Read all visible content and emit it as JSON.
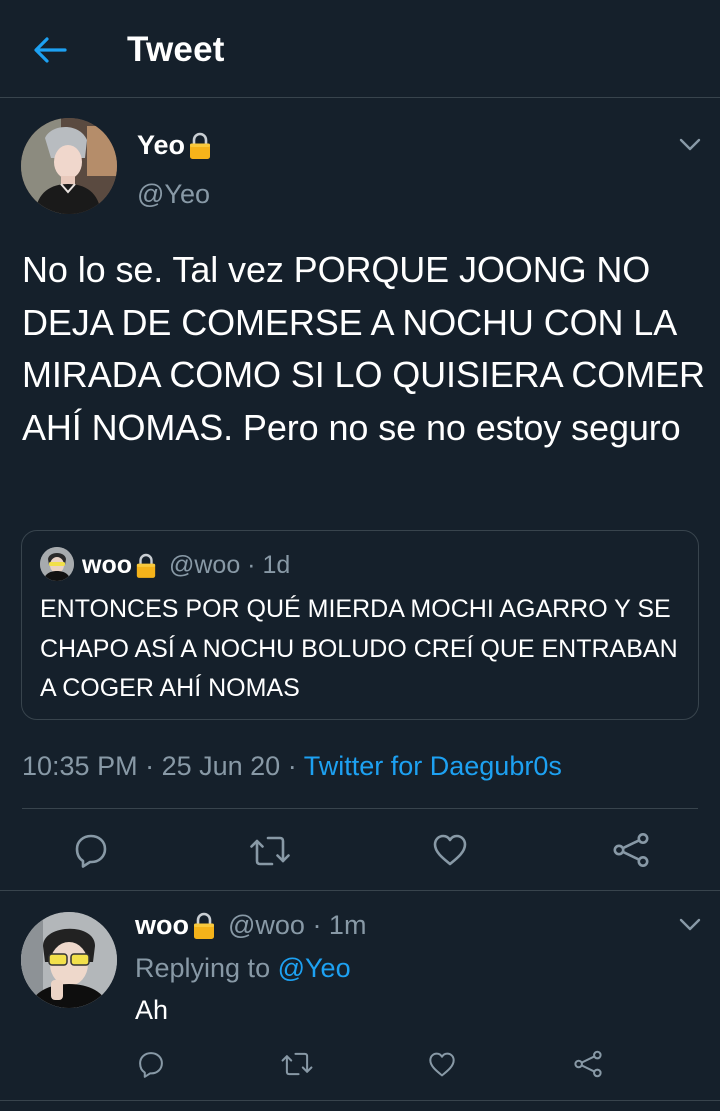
{
  "header": {
    "title": "Tweet"
  },
  "tweet": {
    "author_name": "Yeo",
    "author_handle": "@Yeo",
    "text": "No lo se. Tal vez PORQUE JOONG NO DEJA DE COMERSE A NOCHU CON LA MIRADA COMO SI LO QUISIERA COMER AHÍ NOMAS. Pero no se no estoy seguro",
    "time": "10:35 PM",
    "date": "25 Jun 20",
    "source": "Twitter for Daegubr0s",
    "quote": {
      "author_name": "woo",
      "meta": "@woo · 1d",
      "text": "ENTONCES POR QUÉ MIERDA MOCHI AGARRO Y SE CHAPO ASÍ A NOCHU BOLUDO CREÍ QUE ENTRABAN A COGER AHÍ NOMAS"
    }
  },
  "reply": {
    "author_name": "woo",
    "meta": "@woo · 1m",
    "replying_prefix": "Replying to",
    "replying_to": "@Yeo",
    "text": "Ah"
  },
  "icons": [
    "back-arrow-icon",
    "lock-icon",
    "chevron-down-icon",
    "reply-icon",
    "retweet-icon",
    "like-icon",
    "share-icon"
  ],
  "colors": {
    "background": "#15202b",
    "accent": "#1da1f2",
    "secondary_text": "#8899a6",
    "border": "#38444d",
    "lock": "#f5b31a"
  }
}
